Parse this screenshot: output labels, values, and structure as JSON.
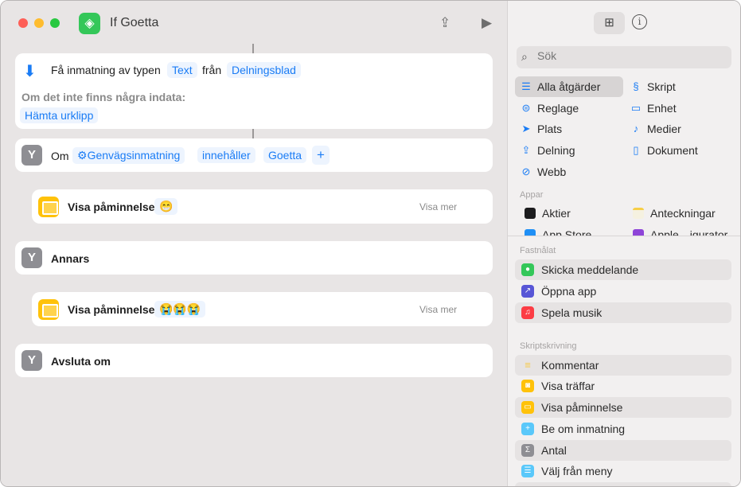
{
  "window": {
    "title": "If Goetta"
  },
  "toolbar": {
    "share_icon": "share-icon",
    "run_icon": "play-icon"
  },
  "actions": {
    "get_input": {
      "label": "Få inmatning av typen",
      "type_token": "Text",
      "from_label": "från",
      "source_token": "Delningsblad",
      "no_input_label": "Om det inte finns några indata:",
      "fallback_token": "Hämta urklipp"
    },
    "if": {
      "label": "Om",
      "input_token": "Genvägsinmatning",
      "condition_token": "innehåller",
      "value_token": "Goetta",
      "add_label": "+"
    },
    "alert1": {
      "label": "Visa påminnelse",
      "emoji": "😁",
      "more": "Visa mer"
    },
    "otherwise": {
      "label": "Annars"
    },
    "alert2": {
      "label": "Visa påminnelse",
      "emoji": "😭😭😭",
      "more": "Visa mer"
    },
    "end_if": {
      "label": "Avsluta om"
    }
  },
  "sidebar": {
    "search_placeholder": "Sök",
    "categories": [
      "Alla åtgärder",
      "Skript",
      "Reglage",
      "Enhet",
      "Plats",
      "Medier",
      "Delning",
      "Dokument",
      "Webb"
    ],
    "apps_header": "Appar",
    "apps": [
      "Aktier",
      "Anteckningar",
      "App Store",
      "Apple…igurator"
    ],
    "pinned_header": "Fastnålat",
    "pinned": [
      "Skicka meddelande",
      "Öppna app",
      "Spela musik"
    ],
    "scripting_header": "Skriptskrivning",
    "scripting": [
      "Kommentar",
      "Visa träffar",
      "Visa påminnelse",
      "Be om inmatning",
      "Antal",
      "Välj från meny"
    ]
  },
  "colors": {
    "accent": "#1a7cf5",
    "green": "#34c759",
    "yellow": "#ffc20a"
  }
}
